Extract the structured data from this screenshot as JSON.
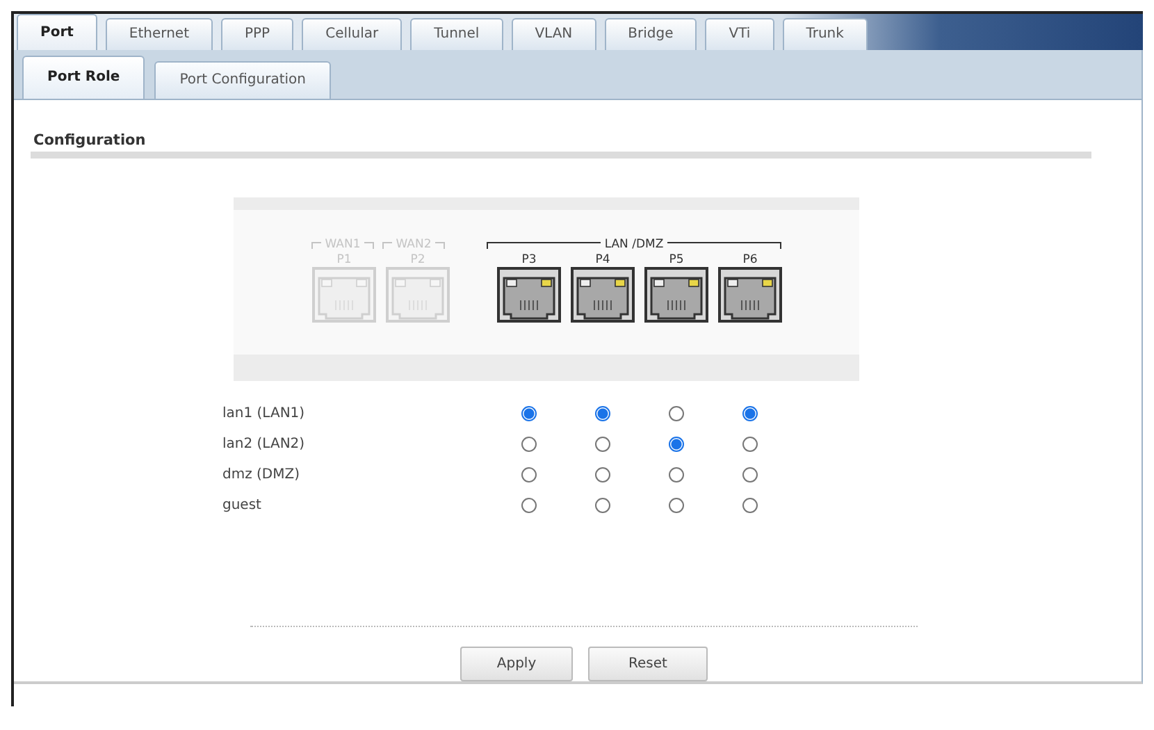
{
  "tabs": [
    {
      "label": "Port",
      "selected": true
    },
    {
      "label": "Ethernet",
      "selected": false
    },
    {
      "label": "PPP",
      "selected": false
    },
    {
      "label": "Cellular",
      "selected": false
    },
    {
      "label": "Tunnel",
      "selected": false
    },
    {
      "label": "VLAN",
      "selected": false
    },
    {
      "label": "Bridge",
      "selected": false
    },
    {
      "label": "VTi",
      "selected": false
    },
    {
      "label": "Trunk",
      "selected": false
    }
  ],
  "subtabs": [
    {
      "label": "Port Role",
      "selected": true
    },
    {
      "label": "Port Configuration",
      "selected": false
    }
  ],
  "section_title": "Configuration",
  "port_panel": {
    "groups": [
      {
        "label": "WAN1",
        "enabled": false,
        "ports": [
          {
            "label": "P1",
            "enabled": false
          }
        ]
      },
      {
        "label": "WAN2",
        "enabled": false,
        "ports": [
          {
            "label": "P2",
            "enabled": false
          }
        ]
      },
      {
        "label": "LAN /DMZ",
        "enabled": true,
        "ports": [
          {
            "label": "P3",
            "enabled": true
          },
          {
            "label": "P4",
            "enabled": true
          },
          {
            "label": "P5",
            "enabled": true
          },
          {
            "label": "P6",
            "enabled": true
          }
        ]
      }
    ]
  },
  "roles": [
    {
      "name": "lan1 (LAN1)",
      "radios": [
        {
          "selected": true
        },
        {
          "selected": true
        },
        {
          "selected": false
        },
        {
          "selected": true
        }
      ]
    },
    {
      "name": "lan2 (LAN2)",
      "radios": [
        {
          "selected": false
        },
        {
          "selected": false
        },
        {
          "selected": true
        },
        {
          "selected": false
        }
      ]
    },
    {
      "name": "dmz (DMZ)",
      "radios": [
        {
          "selected": false
        },
        {
          "selected": false
        },
        {
          "selected": false
        },
        {
          "selected": false
        }
      ]
    },
    {
      "name": "guest",
      "radios": [
        {
          "selected": false
        },
        {
          "selected": false
        },
        {
          "selected": false
        },
        {
          "selected": false
        }
      ]
    }
  ],
  "buttons": [
    "Apply",
    "Reset"
  ]
}
